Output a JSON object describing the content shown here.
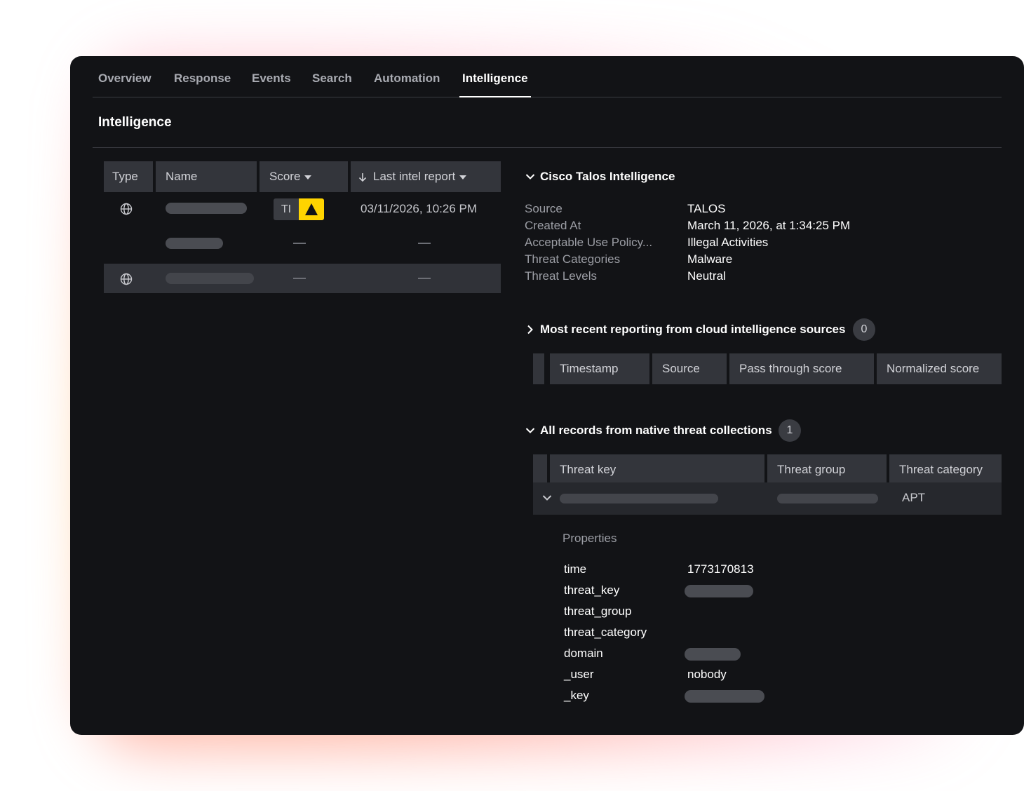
{
  "tabs": [
    {
      "label": "Overview"
    },
    {
      "label": "Response"
    },
    {
      "label": "Events"
    },
    {
      "label": "Search"
    },
    {
      "label": "Automation"
    },
    {
      "label": "Intelligence",
      "active": true
    }
  ],
  "page_title": "Intelligence",
  "left_table": {
    "headers": {
      "type": "Type",
      "name": "Name",
      "score": "Score",
      "last_intel_report": "Last intel report"
    },
    "rows": [
      {
        "score_badge": "TI",
        "last_report": "03/11/2026, 10:26 PM"
      },
      {},
      {}
    ]
  },
  "talos": {
    "title": "Cisco Talos Intelligence",
    "fields": [
      {
        "label": "Source",
        "value": "TALOS"
      },
      {
        "label": "Created At",
        "value": "March 11, 2026, at 1:34:25 PM"
      },
      {
        "label": "Acceptable Use Policy...",
        "value": "Illegal Activities"
      },
      {
        "label": "Threat Categories",
        "value": "Malware"
      },
      {
        "label": "Threat Levels",
        "value": "Neutral"
      }
    ]
  },
  "cloud": {
    "title": "Most recent reporting from cloud intelligence sources",
    "count": "0",
    "headers": [
      "Timestamp",
      "Source",
      "Pass through score",
      "Normalized score"
    ]
  },
  "native": {
    "title": "All records from native threat collections",
    "count": "1",
    "headers": [
      "Threat key",
      "Threat group",
      "Threat category"
    ],
    "row": {
      "threat_category": "APT"
    },
    "properties_title": "Properties",
    "properties": [
      {
        "key": "time",
        "value": "1773170813"
      },
      {
        "key": "threat_key",
        "value": ""
      },
      {
        "key": "threat_group",
        "value": ""
      },
      {
        "key": "threat_category",
        "value": ""
      },
      {
        "key": "domain",
        "value": ""
      },
      {
        "key": "_user",
        "value": "nobody"
      },
      {
        "key": "_key",
        "value": ""
      }
    ]
  },
  "colors": {
    "background": "#121316",
    "header_cell": "#33353b",
    "warning": "#ffd400"
  }
}
